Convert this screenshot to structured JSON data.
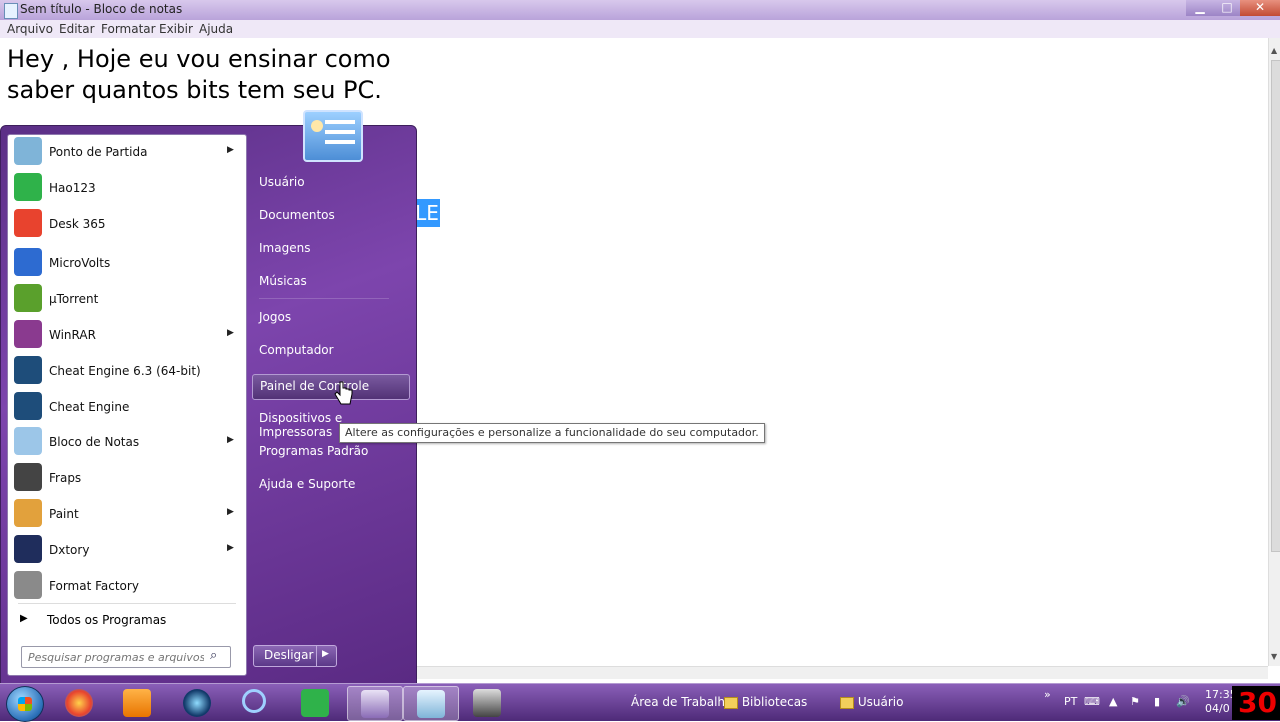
{
  "window": {
    "title": "Sem título - Bloco de notas",
    "menu": [
      "Arquivo",
      "Editar",
      "Formatar",
      "Exibir",
      "Ajuda"
    ],
    "buttons": {
      "minimize": "▁",
      "maximize": "□",
      "close": "✕"
    }
  },
  "editor": {
    "line1": "Hey , Hoje eu vou ensinar como",
    "line2": "saber quantos bits tem seu PC.",
    "stray_selection": "LE"
  },
  "start_menu": {
    "programs": [
      {
        "label": "Ponto de Partida",
        "submenu": true,
        "icon": "getting-started-icon",
        "color": "#7fb4d8"
      },
      {
        "label": "Hao123",
        "submenu": false,
        "icon": "hao123-icon",
        "color": "#2fb24a"
      },
      {
        "label": "Desk 365",
        "submenu": false,
        "icon": "desk365-icon",
        "color": "#e8432e"
      },
      {
        "label": "MicroVolts",
        "submenu": false,
        "icon": "microvolts-icon",
        "color": "#2d6bd1"
      },
      {
        "label": "µTorrent",
        "submenu": false,
        "icon": "utorrent-icon",
        "color": "#5aa02c"
      },
      {
        "label": "WinRAR",
        "submenu": true,
        "icon": "winrar-icon",
        "color": "#8a3a8f"
      },
      {
        "label": "Cheat Engine 6.3 (64-bit)",
        "submenu": false,
        "icon": "cheat-engine-icon",
        "color": "#1e4d7a"
      },
      {
        "label": "Cheat Engine",
        "submenu": false,
        "icon": "cheat-engine-icon",
        "color": "#1e4d7a"
      },
      {
        "label": "Bloco de Notas",
        "submenu": true,
        "icon": "notepad-icon",
        "color": "#9cc6e8"
      },
      {
        "label": "Fraps",
        "submenu": false,
        "icon": "fraps-icon",
        "color": "#444444"
      },
      {
        "label": "Paint",
        "submenu": true,
        "icon": "paint-icon",
        "color": "#e2a13c"
      },
      {
        "label": "Dxtory",
        "submenu": true,
        "icon": "dxtory-icon",
        "color": "#1f2d5c"
      },
      {
        "label": "Format Factory",
        "submenu": false,
        "icon": "format-factory-icon",
        "color": "#8a8a8a"
      }
    ],
    "all_programs": "Todos os Programas",
    "search_placeholder": "Pesquisar programas e arquivos",
    "right_items": [
      "Usuário",
      "Documentos",
      "Imagens",
      "Músicas",
      "Jogos",
      "Computador",
      "Painel de Controle",
      "Dispositivos e Impressoras",
      "Programas Padrão",
      "Ajuda e Suporte"
    ],
    "hot_item": "Painel de Controle",
    "shutdown_label": "Desligar",
    "tooltip": "Altere as configurações e personalize a funcionalidade do seu computador."
  },
  "taskbar": {
    "toolbar_items": [
      "Área de Trabalho",
      "Bibliotecas",
      "Usuário"
    ],
    "tray": {
      "language": "PT",
      "time": "17:35",
      "date": "04/0"
    },
    "recording_badge": "30"
  }
}
